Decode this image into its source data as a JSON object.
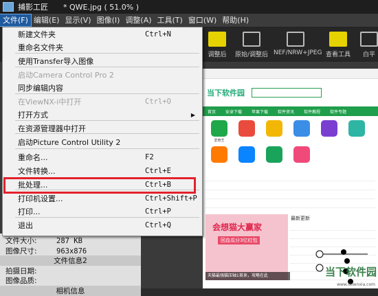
{
  "titlebar": {
    "app_name": "捕影工匠",
    "doc_title": "* QWE.jpg ( 51.0% )"
  },
  "menubar": [
    {
      "label": "文件(F)",
      "active": true
    },
    {
      "label": "编辑(E)"
    },
    {
      "label": "显示(V)"
    },
    {
      "label": "图像(I)"
    },
    {
      "label": "调整(A)"
    },
    {
      "label": "工具(T)"
    },
    {
      "label": "窗口(W)"
    },
    {
      "label": "帮助(H)"
    }
  ],
  "toolbar": {
    "btn1": "调整后",
    "btn2": "原始/调整后",
    "btn3": "NEF/NRW+JPEG",
    "btn4": "查看工具",
    "btn5": "白平"
  },
  "file_menu": {
    "items": [
      {
        "label": "新建文件夹",
        "shortcut": "Ctrl+N"
      },
      {
        "label": "重命名文件夹",
        "shortcut": ""
      },
      {
        "label": "使用Transfer导入图像",
        "shortcut": ""
      },
      {
        "label": "启动Camera Control Pro 2",
        "shortcut": "",
        "disabled": true
      },
      {
        "label": "同步编辑内容",
        "shortcut": ""
      },
      {
        "label": "在ViewNX-i中打开",
        "shortcut": "Ctrl+O",
        "disabled": true
      },
      {
        "label": "打开方式",
        "shortcut": "",
        "submenu": true
      },
      {
        "label": "在资源管理器中打开",
        "shortcut": ""
      },
      {
        "label": "启动Picture Control Utility 2",
        "shortcut": ""
      },
      {
        "label": "重命名...",
        "shortcut": "F2"
      },
      {
        "label": "文件转换...",
        "shortcut": "Ctrl+E"
      },
      {
        "label": "批处理...",
        "shortcut": "Ctrl+B"
      },
      {
        "label": "打印机设置...",
        "shortcut": "Ctrl+Shift+P"
      },
      {
        "label": "打印...",
        "shortcut": "Ctrl+P"
      },
      {
        "label": "退出",
        "shortcut": "Ctrl+Q"
      }
    ]
  },
  "info": {
    "file_size_label": "文件大小:",
    "file_size_value": "287 KB",
    "image_size_label": "图像尺寸:",
    "image_size_value": "963x876",
    "section_file_info2": "文件信息2",
    "shoot_date_label": "拍摄日期:",
    "quality_label": "图像品质:",
    "section_camera_info": "相机信息"
  },
  "webpage": {
    "logo": "当下软件园",
    "nav": [
      "首页",
      "安卓下载",
      "苹果下载",
      "软件资讯",
      "软件教程",
      "软件专题"
    ],
    "apps": [
      "爱奇艺",
      "",
      "",
      "",
      "",
      "",
      "",
      "",
      "",
      ""
    ],
    "banner_title": "会想猫大赢家",
    "banner_sub": "回血瓜分3亿红包",
    "banner_caption": "天猫最强猫压轴1首来，攻略在此",
    "latest_header": "最新更新",
    "watermark": "当下软件园",
    "watermark_sub": "www.downxia.com"
  },
  "colors": {
    "menu_highlight_border": "#e3212b",
    "menubar_active": "#1f5a9e"
  }
}
